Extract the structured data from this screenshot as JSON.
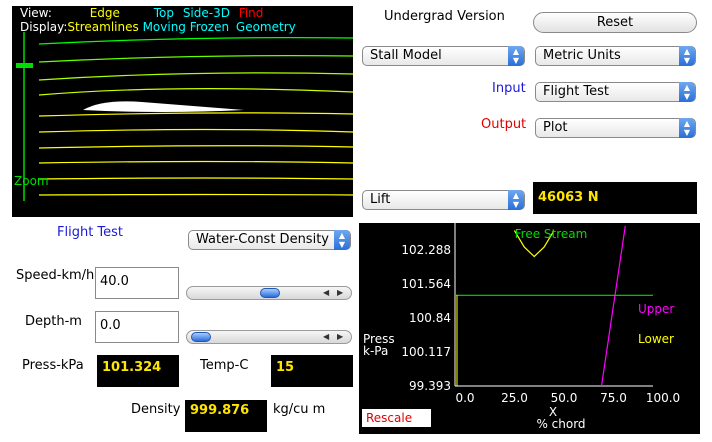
{
  "view_panel": {
    "view_label": "View:",
    "view_options": [
      "Edge",
      "Top",
      "Side-3D",
      "Find"
    ],
    "display_label": "Display:",
    "display_options": [
      "Streamlines",
      "Moving",
      "Frozen",
      "Geometry"
    ],
    "zoom_label": "Zoom",
    "colors": {
      "edge": "#ffff00",
      "top": "#00ffff",
      "side": "#00ffff",
      "find": "#ff0000",
      "streamlines": "#ffff00",
      "moving": "#00ffff",
      "frozen": "#00ffff",
      "geometry": "#00ffff",
      "zoom": "#00dd00"
    }
  },
  "controls": {
    "version_label": "Undergrad Version",
    "reset_button": "Reset",
    "model_select": "Stall Model",
    "units_select": "Metric Units",
    "input_label": "Input",
    "input_select": "Flight Test",
    "output_label": "Output",
    "output_select": "Plot",
    "result_select": "Lift",
    "result_value": "46063 N"
  },
  "flight_test": {
    "title": "Flight Test",
    "environment_select": "Water-Const Density",
    "speed_label": "Speed-km/h",
    "speed_value": "40.0",
    "speed_slider": 0.55,
    "depth_label": "Depth-m",
    "depth_value": "0.0",
    "depth_slider": 0.0,
    "press_label": "Press-kPa",
    "press_value": "101.324",
    "temp_label": "Temp-C",
    "temp_value": "15",
    "density_label": "Density",
    "density_value": "999.876",
    "density_unit": "kg/cu m"
  },
  "chart_data": {
    "type": "line",
    "title": "Free Stream",
    "ylabel_line1": "Press",
    "ylabel_line2": "k-Pa",
    "xlabel_line1": "X",
    "xlabel_line2": "% chord",
    "ylim": [
      99.393,
      102.288
    ],
    "xlim": [
      0.0,
      100.0
    ],
    "y_ticks": [
      "102.288",
      "101.564",
      "100.84",
      "100.117",
      "99.393"
    ],
    "x_ticks": [
      "0.0",
      "25.0",
      "50.0",
      "75.0",
      "100.0"
    ],
    "free_stream_pressure": 101.324,
    "legend": [
      {
        "name": "Upper",
        "color": "#ff00ff"
      },
      {
        "name": "Lower",
        "color": "#ffff00"
      }
    ],
    "series": [
      {
        "name": "Upper",
        "color": "#ff00ff",
        "points": [
          [
            74,
            99.393
          ],
          [
            86,
            102.8
          ]
        ]
      },
      {
        "name": "Lower",
        "color": "#ffff00",
        "points": [
          [
            30,
            102.7
          ],
          [
            35,
            102.35
          ],
          [
            40,
            102.15
          ],
          [
            45,
            102.35
          ],
          [
            50,
            102.7
          ]
        ]
      },
      {
        "name": "Free Stream",
        "color": "#00dd00",
        "points": [
          [
            0,
            101.324
          ],
          [
            100,
            101.324
          ]
        ]
      }
    ],
    "rescale_button": "Rescale"
  }
}
